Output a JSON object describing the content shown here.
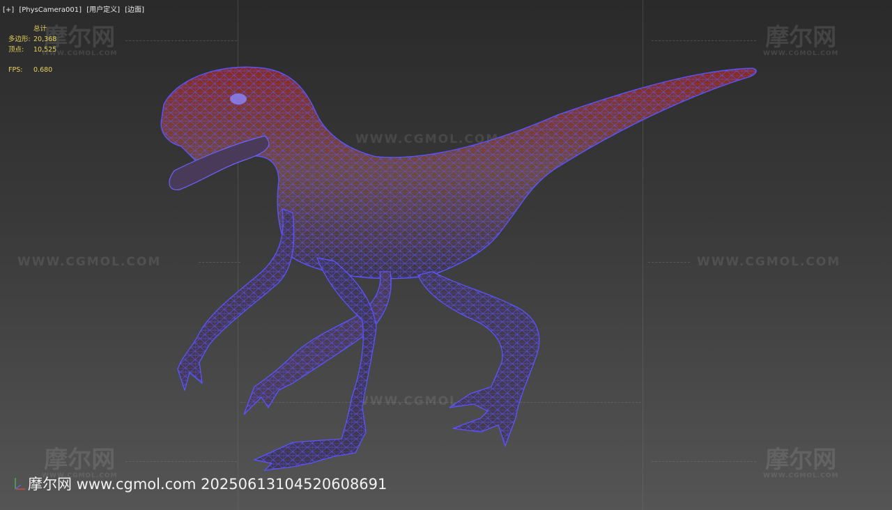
{
  "viewport": {
    "menu_label": "[+]",
    "camera_label": "[PhysCamera001]",
    "mode_label": "[用户定义]",
    "shading_label": "[边面]"
  },
  "stats": {
    "header": "总计",
    "polygons_label": "多边形:",
    "polygons_value": "20,368",
    "vertices_label": "顶点:",
    "vertices_value": "10,525",
    "fps_label": "FPS:",
    "fps_value": "0.680"
  },
  "watermarks": {
    "logo_cn": "摩尔网",
    "logo_en": "WWW.CGMOL.COM",
    "url_text": "WWW.CGMOL.COM"
  },
  "footer": {
    "text": "摩尔网 www.cgmol.com 20250613104520608691"
  },
  "colors": {
    "stats_text": "#e8d25a",
    "wire": "#5a55ff",
    "body_red": "#8a2a1e",
    "body_brown": "#6e4a3a"
  },
  "icons": {
    "axis": "axis-gizmo-icon"
  }
}
